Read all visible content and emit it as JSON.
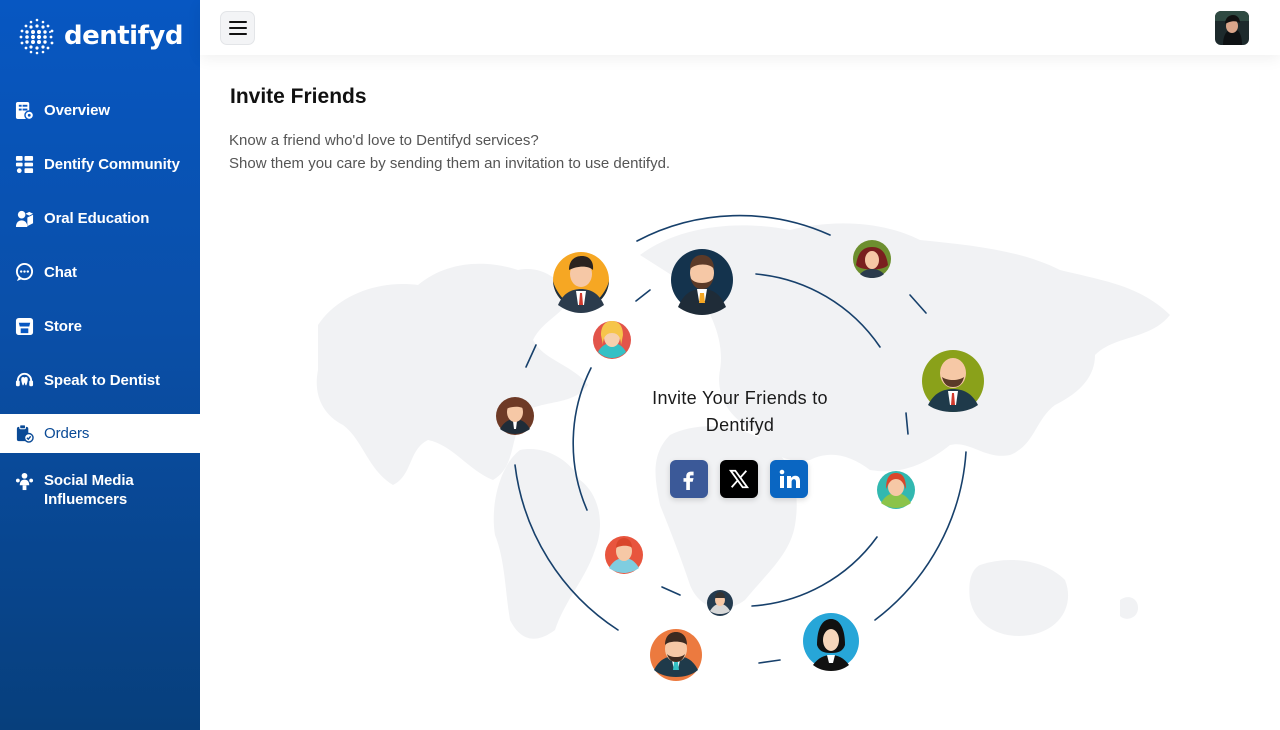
{
  "brand": {
    "name": "dentifyd"
  },
  "sidebar": {
    "items": [
      {
        "label": "Overview",
        "icon": "overview-icon"
      },
      {
        "label": "Dentify Community",
        "icon": "community-icon"
      },
      {
        "label": "Oral Education",
        "icon": "education-icon"
      },
      {
        "label": "Chat",
        "icon": "chat-icon"
      },
      {
        "label": "Store",
        "icon": "store-icon"
      },
      {
        "label": "Speak to Dentist",
        "icon": "dentist-icon"
      },
      {
        "label": "Orders",
        "icon": "orders-icon",
        "active": true
      },
      {
        "label_line1": "Social Media",
        "label_line2": "Influemcers",
        "icon": "influencers-icon"
      }
    ]
  },
  "header": {
    "menu_icon": "hamburger-icon",
    "avatar": "user-avatar"
  },
  "page": {
    "title": "Invite Friends",
    "line1": "Know a friend who'd love to Dentifyd services?",
    "line2": "Show them you care by sending them an invitation to use dentifyd.",
    "center_line1": "Invite Your Friends to",
    "center_line2": "Dentifyd"
  },
  "socials": [
    {
      "name": "facebook",
      "icon": "facebook-icon"
    },
    {
      "name": "x",
      "icon": "x-icon"
    },
    {
      "name": "linkedin",
      "icon": "linkedin-icon"
    }
  ],
  "colors": {
    "sidebar_top": "#0757c2",
    "sidebar_bottom": "#073f7c",
    "accent": "#0a4a96",
    "orbit_line": "#17406b"
  }
}
